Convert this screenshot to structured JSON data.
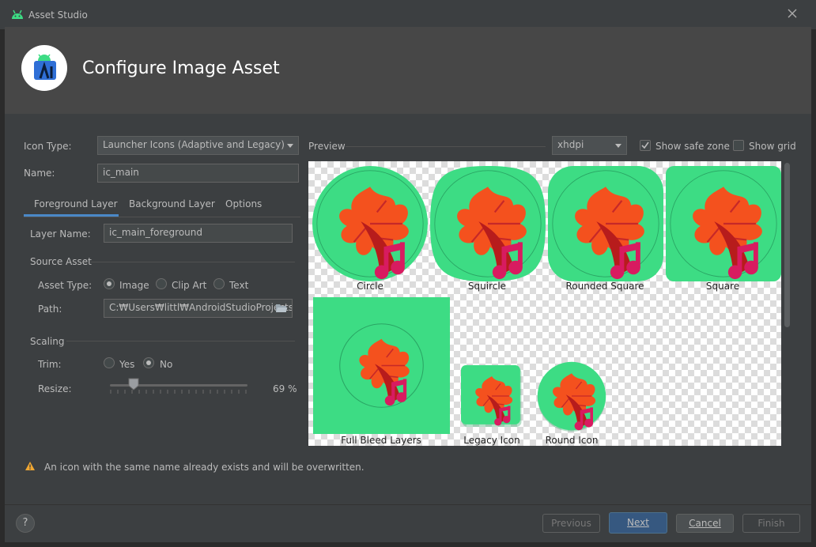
{
  "window": {
    "title": "Asset Studio"
  },
  "header": {
    "title": "Configure Image Asset"
  },
  "form": {
    "icon_type_label": "Icon Type:",
    "icon_type_value": "Launcher Icons (Adaptive and Legacy)",
    "name_label": "Name:",
    "name_value": "ic_main"
  },
  "tabs": [
    {
      "label": "Foreground Layer",
      "selected": true
    },
    {
      "label": "Background Layer",
      "selected": false
    },
    {
      "label": "Options",
      "selected": false
    }
  ],
  "layer": {
    "layer_name_label": "Layer Name:",
    "layer_name_value": "ic_main_foreground",
    "source_asset_title": "Source Asset",
    "asset_type_label": "Asset Type:",
    "asset_type_options": [
      "Image",
      "Clip Art",
      "Text"
    ],
    "asset_type_selected": "Image",
    "path_label": "Path:",
    "path_value": "C:₩Users₩littl₩AndroidStudioProjects₩",
    "scaling_title": "Scaling",
    "trim_label": "Trim:",
    "trim_options": [
      "Yes",
      "No"
    ],
    "trim_selected": "No",
    "resize_label": "Resize:",
    "resize_value": 69,
    "resize_text": "69 %"
  },
  "preview": {
    "label": "Preview",
    "density": "xhdpi",
    "show_safe_zone_label": "Show safe zone",
    "show_safe_zone": true,
    "show_grid_label": "Show grid",
    "show_grid": false,
    "captions": {
      "circle": "Circle",
      "squircle": "Squircle",
      "rounded_square": "Rounded Square",
      "square": "Square",
      "full_bleed": "Full Bleed Layers",
      "legacy": "Legacy Icon",
      "round": "Round Icon"
    }
  },
  "warning": {
    "text": "An icon with the same name already exists and will be overwritten."
  },
  "footer": {
    "help": "?",
    "previous": "Previous",
    "next": "Next",
    "cancel": "Cancel",
    "finish": "Finish"
  },
  "colors": {
    "icon_background": "#3ddc84",
    "leaf_primary": "#f4511e",
    "leaf_dark": "#b71c1c",
    "note": "#d81b60",
    "warning": "#f0a732",
    "default_button": "#365880"
  }
}
